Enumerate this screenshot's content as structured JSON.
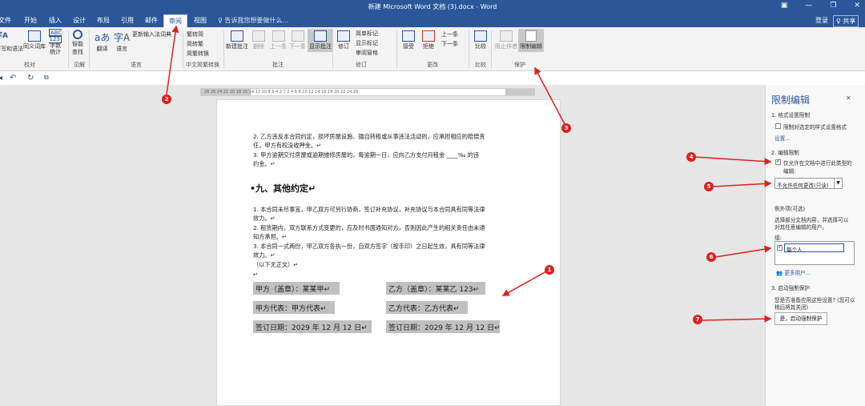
{
  "window": {
    "title": "新建 Microsoft Word 文档 (3).docx - Word",
    "minimize": "—",
    "maximize": "❐",
    "close": "✕",
    "ribbon_display": "▣"
  },
  "tabs": {
    "items": [
      "文件",
      "开始",
      "插入",
      "设计",
      "布局",
      "引用",
      "邮件",
      "审阅",
      "视图"
    ],
    "active": "审阅",
    "tell_me": "♀ 告诉我您想要做什么...",
    "signin": "登录",
    "share": "♀ 共享"
  },
  "ribbon": {
    "proofing": {
      "spell": "字A",
      "spell_label": "拼写和语法",
      "thesaurus": "同义词库",
      "wordcount": "字数\n统计",
      "group": "校对"
    },
    "insights": {
      "smart_lookup": "智能\n查找",
      "group": "见解"
    },
    "language": {
      "translate": "翻译",
      "language": "语言",
      "update_ime": "更新输入法词典",
      "group": "语言"
    },
    "chinese": {
      "to_trad": "繁转简",
      "to_simp": "简转繁",
      "convert": "简繁转换",
      "group": "中文简繁转换"
    },
    "comments": {
      "new": "新建批注",
      "delete": "删除",
      "prev": "上一条",
      "next": "下一条",
      "show": "显示批注",
      "group": "批注"
    },
    "tracking": {
      "track": "修订",
      "simple_markup": "简单标记",
      "show_markup": "显示标记",
      "review_pane": "审阅窗格",
      "group": "修订"
    },
    "changes": {
      "accept": "接受",
      "reject": "拒绝",
      "prev": "上一条",
      "next": "下一条",
      "group": "更改"
    },
    "compare": {
      "compare": "比较",
      "group": "比较"
    },
    "protect": {
      "block_authors": "阻止作者",
      "restrict": "限制编辑",
      "group": "保护"
    }
  },
  "ruler": {
    "numbers": "28 26 24 22 20 18 16 14 12 10 8 6 4 2 ⌶ 2 4 6 8 10 12 14 16 18 20 22 24 26"
  },
  "document": {
    "para1": "2. 乙方违反本合同约定，损坏房屋设施、擅自转租或从事违法活动的，应承担相应的赔偿责",
    "para1b": "任，甲方有权没收押金。↵",
    "para2": "3. 甲方逾期交付房屋或逾期维修房屋的，每逾期一日，应向乙方支付月租金 ____‰ 的违",
    "para2b": "约金。↵",
    "heading": "•九、其他约定↵",
    "p3": "1. 本合同未尽事宜，甲乙双方可另行协商，签订补充协议，补充协议与本合同具有同等法律",
    "p3b": "效力。↵",
    "p4": "2. 租赁期内，双方联系方式变更的，应及时书面通知对方，否则因此产生的相关责任由未通",
    "p4b": "知方承担。↵",
    "p5": "3. 本合同一式两份，甲乙双方各执一份，自双方签字（按手印）之日起生效，具有同等法律",
    "p5b": "效力。↵",
    "p6": "（以下无正文）↵",
    "p7": "↵",
    "sig": {
      "a_party": "甲方（盖章）：某某甲↵",
      "b_party": "乙方（盖章）：某某乙 123↵",
      "a_rep": "甲方代表：甲方代表↵",
      "b_rep": "乙方代表：乙方代表↵",
      "a_date": "签订日期：2029 年 12 月 12 日↵",
      "b_date": "签订日期：2029 年 12 月 12 日↵"
    }
  },
  "pane": {
    "title": "限制编辑",
    "close": "✕",
    "s1": "1. 格式设置限制",
    "s1_check": "限制对选定的样式设置格式",
    "s1_link": "设置...",
    "s2": "2. 编辑限制",
    "s2_check": "仅允许在文档中进行此类型的",
    "s2_check2": "编辑:",
    "s2_select": "不允许任何更改(只读)",
    "ex_title": "例外项(可选)",
    "ex_desc1": "选择部分文档内容，并选择可以",
    "ex_desc2": "对其任意编辑的用户。",
    "ex_group": "组:",
    "ex_everyone": "每个人",
    "more_users": "更多用户...",
    "s3": "3. 启动强制保护",
    "s3_q1": "您是否准备应用这些设置? (您可以",
    "s3_q2": "稍后将其关闭)",
    "s3_btn": "是，启动强制保护"
  },
  "annotations": [
    "1",
    "2",
    "3",
    "4",
    "5",
    "6",
    "7"
  ],
  "colors": {
    "word_blue": "#2b579a",
    "arrow_red": "#e02020"
  }
}
